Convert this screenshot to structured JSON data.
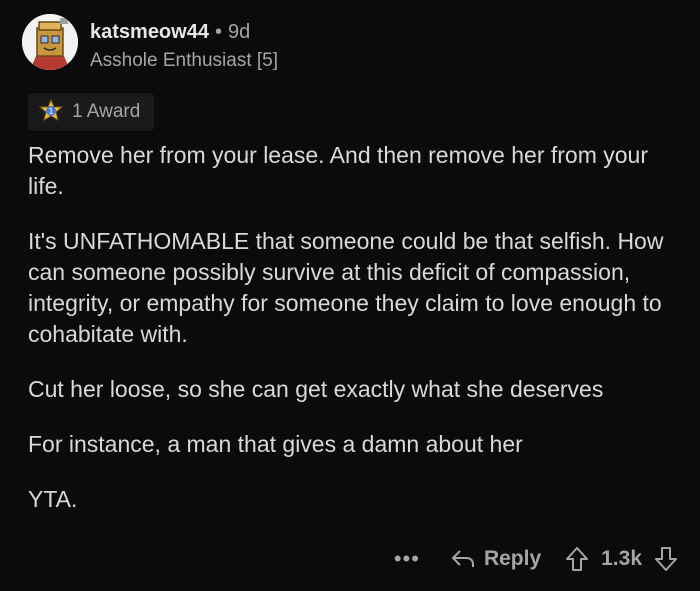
{
  "comment": {
    "username": "katsmeow44",
    "separator": "•",
    "age": "9d",
    "flair": "Asshole Enthusiast [5]",
    "avatar_icon": "avatar-icon",
    "award": {
      "icon": "award-icon",
      "label": "1 Award"
    },
    "paragraphs": [
      "Remove her from your lease. And then remove her from your life.",
      "It's UNFATHOMABLE that someone could be that selfish. How can someone possibly survive at this deficit of compassion,  integrity,  or empathy for someone they claim to love enough to cohabitate with.",
      "Cut her loose, so she can get exactly what she deserves",
      "For instance,  a man that gives a damn about her",
      "YTA."
    ]
  },
  "actions": {
    "more_label": "•••",
    "reply_label": "Reply",
    "score": "1.3k"
  },
  "colors": {
    "background": "#0b0b0c",
    "text": "#d7dadc",
    "muted": "#a3a5a8"
  }
}
